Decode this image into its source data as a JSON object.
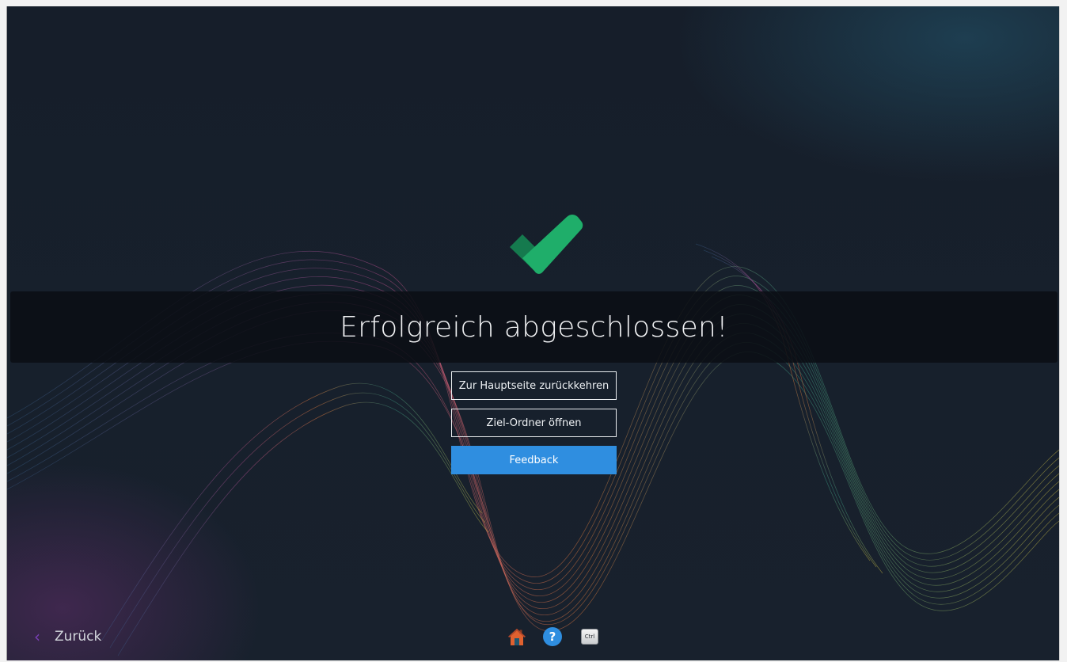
{
  "screen": {
    "title": "Erfolgreich abgeschlossen!"
  },
  "actions": {
    "return_home_label": "Zur Hauptseite zurückkehren",
    "open_folder_label": "Ziel-Ordner öffnen",
    "feedback_label": "Feedback"
  },
  "footer": {
    "back_label": "Zurück",
    "back_chevron": "‹",
    "help_glyph": "?",
    "ctrl_label": "Ctrl",
    "icons": [
      "home-icon",
      "help-icon",
      "ctrl-key-icon"
    ]
  },
  "colors": {
    "background": "#17202c",
    "accent_blue": "#2f8ee0",
    "success_green": "#1fae6a",
    "back_chevron": "#7a3fb7"
  }
}
